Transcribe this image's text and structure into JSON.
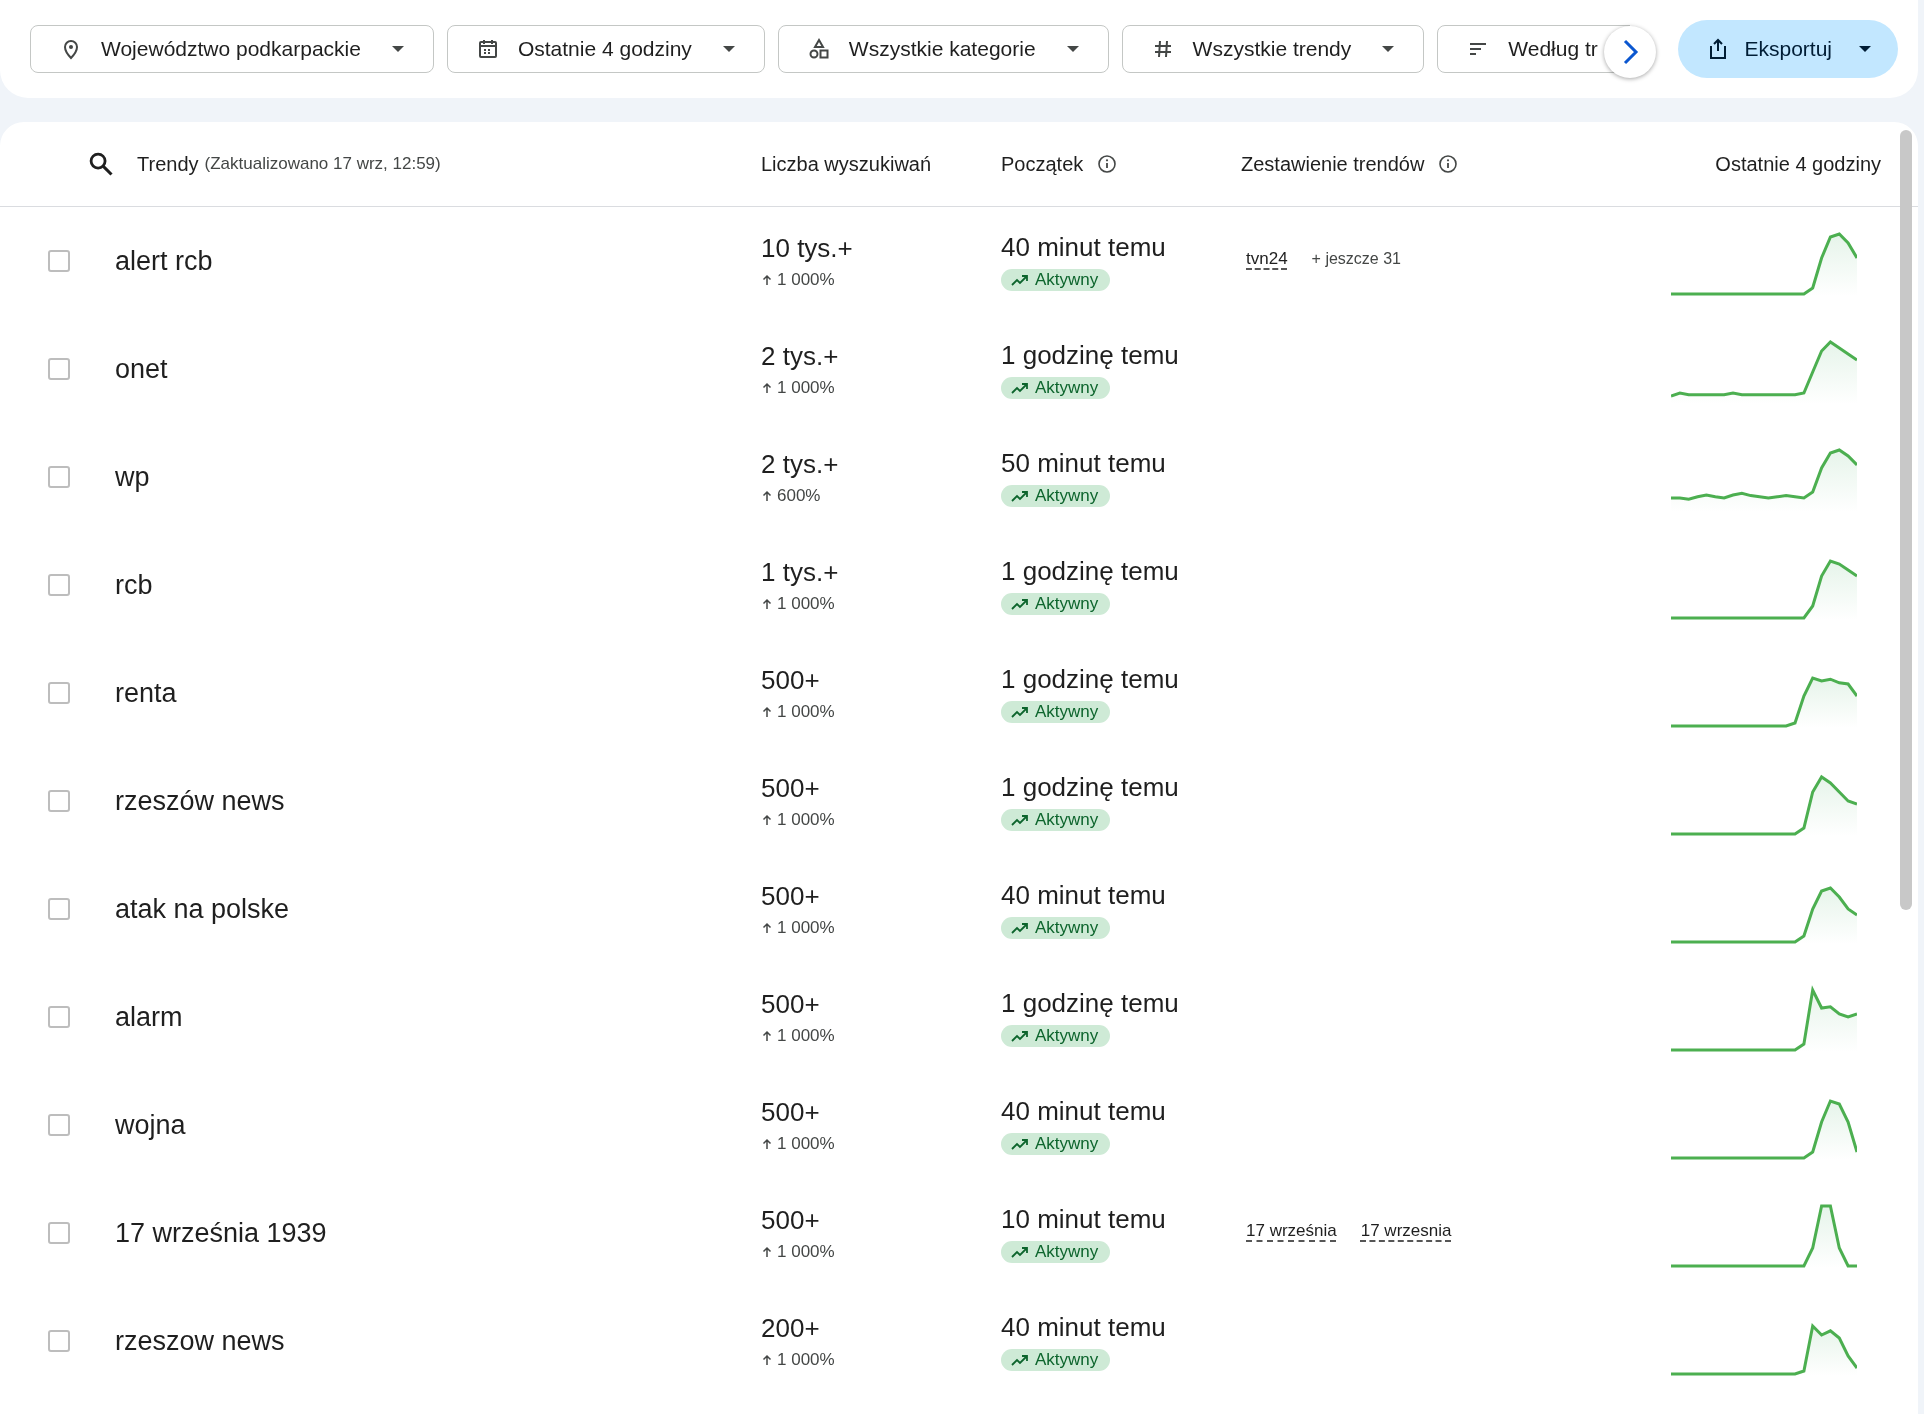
{
  "filters": [
    {
      "kind": "location",
      "label": "Województwo podkarpackie"
    },
    {
      "kind": "calendar",
      "label": "Ostatnie 4 godziny"
    },
    {
      "kind": "category",
      "label": "Wszystkie kategorie"
    },
    {
      "kind": "hash",
      "label": "Wszystkie trendy"
    },
    {
      "kind": "sort",
      "label": "Według tr"
    }
  ],
  "export": {
    "label": "Eksportuj"
  },
  "table": {
    "columns": [
      {
        "label": "Trendy",
        "note": "(Zaktualizowano 17 wrz, 12:59)",
        "info": false
      },
      {
        "label": "Liczba wyszukiwań",
        "info": false
      },
      {
        "label": "Początek",
        "info": true
      },
      {
        "label": "Zestawienie trendów",
        "info": true
      },
      {
        "label": "Ostatnie 4 godziny",
        "info": false
      }
    ],
    "rows": [
      {
        "term": "alert rcb",
        "checked": false,
        "volume": "10 tys.+",
        "growth": "1 000%",
        "started": "40 minut temu",
        "status": "Aktywny",
        "breakdown": [
          "tvn24"
        ],
        "more": "+ jeszcze 31"
      },
      {
        "term": "onet",
        "checked": false,
        "volume": "2 tys.+",
        "growth": "1 000%",
        "started": "1 godzinę temu",
        "status": "Aktywny"
      },
      {
        "term": "wp",
        "checked": false,
        "volume": "2 tys.+",
        "growth": "600%",
        "started": "50 minut temu",
        "status": "Aktywny"
      },
      {
        "term": "rcb",
        "checked": false,
        "volume": "1 tys.+",
        "growth": "1 000%",
        "started": "1 godzinę temu",
        "status": "Aktywny"
      },
      {
        "term": "renta",
        "checked": false,
        "volume": "500+",
        "growth": "1 000%",
        "started": "1 godzinę temu",
        "status": "Aktywny"
      },
      {
        "term": "rzeszów news",
        "checked": false,
        "volume": "500+",
        "growth": "1 000%",
        "started": "1 godzinę temu",
        "status": "Aktywny"
      },
      {
        "term": "atak na polske",
        "checked": false,
        "volume": "500+",
        "growth": "1 000%",
        "started": "40 minut temu",
        "status": "Aktywny"
      },
      {
        "term": "alarm",
        "checked": false,
        "volume": "500+",
        "growth": "1 000%",
        "started": "1 godzinę temu",
        "status": "Aktywny"
      },
      {
        "term": "wojna",
        "checked": false,
        "volume": "500+",
        "growth": "1 000%",
        "started": "40 minut temu",
        "status": "Aktywny"
      },
      {
        "term": "17 września 1939",
        "checked": false,
        "volume": "500+",
        "growth": "1 000%",
        "started": "10 minut temu",
        "status": "Aktywny",
        "breakdown": [
          "17 września",
          "17 wrzesnia"
        ]
      },
      {
        "term": "rzeszow news",
        "checked": false,
        "volume": "200+",
        "growth": "1 000%",
        "started": "40 minut temu",
        "status": "Aktywny"
      }
    ]
  }
}
